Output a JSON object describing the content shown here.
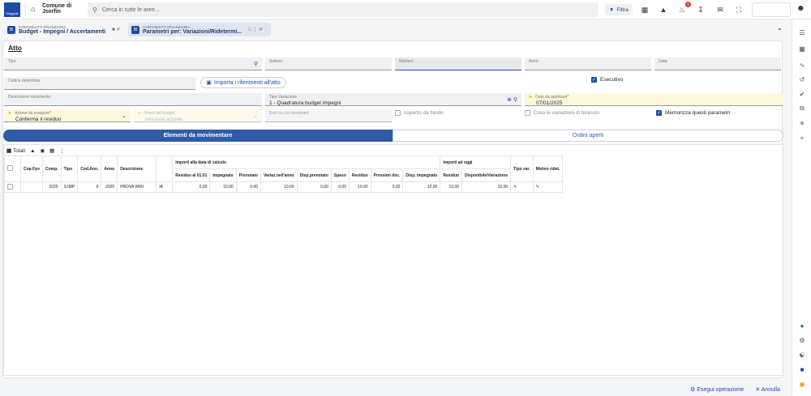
{
  "app": {
    "org_line1": "Comune di",
    "org_line2": "Jserfin",
    "logo_text": "Maggioli"
  },
  "search": {
    "placeholder": "Cerca in tutte le aree..."
  },
  "topbar": {
    "filter_label": "Filtra",
    "notif_count": "1"
  },
  "tabs": [
    {
      "sub": "CONTABILITÀ FINANZIARIA",
      "main": "Budget - Impegni / Accertamenti"
    },
    {
      "sub": "CONTABILITÀ FINANZIARIA",
      "main": "Parametri per: Variazioni/Ridetermi..."
    }
  ],
  "form": {
    "section_title": "Atto",
    "tipo_label": "Tipo",
    "settore_label": "Settore",
    "numero_label": "Numero",
    "anno_label": "Anno",
    "data_label": "Data",
    "codice_label": "Codice determina",
    "import_button": "Importa i riferimenti all'atto",
    "esecutivo_label": "Esecutivo",
    "descrizione_label": "Descrizione movimento",
    "tipo_variazione_label": "Tipo Variazione",
    "tipo_variazione_value": "1 - Quadratura budget impegni",
    "data_applicare_label": "Data da applicare",
    "data_applicare_value": "07/01/2025",
    "azione_label": "Azione da eseguire",
    "azione_value": "Conferma il residuo",
    "rows_label": "Rows del budget",
    "rows_value": "nessuna azione",
    "importo_placeholder": "Entri su cui riempirare",
    "coperto_label": "coperto da fondo",
    "crea_label": "Crea le variazioni di bilancio",
    "memorizza_label": "Memorizza questi parametri"
  },
  "segments": {
    "active": "Elementi da movimentare",
    "inactive": "Ordini aperti"
  },
  "grid": {
    "toolbar_label": "Totali",
    "headers": {
      "cop": "Cop.Fpv",
      "comp": "Comp.",
      "tipo": "Tipo",
      "codann": "Cod.Ann.",
      "anno": "Anno",
      "desc": "Descrizione",
      "group1": "Importi alla data di calcolo",
      "group2": "Importi ad oggi",
      "tipovar": "Tipo var.",
      "motivo": "Motivo ridet.",
      "res01": "Residuo al 01.01",
      "impegnato": "Impegnato",
      "prenotato": "Prenotato",
      "variaz": "Variaz.nell'anno",
      "dispren": "Disp.prenotato",
      "speso": "Speso",
      "residuo": "Residuo",
      "prossimi": "Prossimi doc.",
      "dispimp": "Disp. impegnato",
      "residuo2": "Residuo",
      "disponibile": "Disponibile/Variazione"
    },
    "row": {
      "comp": "2025",
      "tipo": "S.IMP",
      "codann": "6",
      "anno": "2025",
      "desc": "PROVA WIKI",
      "extra": "IA",
      "res01": "0,00",
      "impegnato": "10,00",
      "prenotato": "0,00",
      "variaz": "10,00",
      "dispren": "0,00",
      "speso": "0,00",
      "residuo": "10,00",
      "prossimi": "0,00",
      "dispimp": "10,00",
      "residuo2": "10,00",
      "disponibile": "10,00"
    }
  },
  "footer": {
    "execute": "Esegui operazione",
    "cancel": "Annulla"
  }
}
